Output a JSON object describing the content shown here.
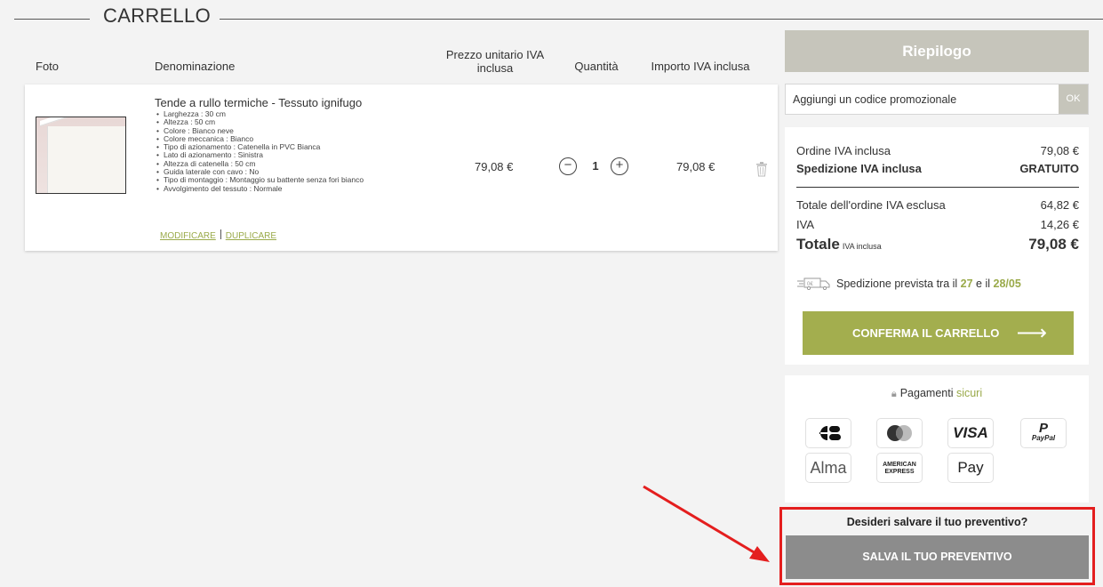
{
  "cart_title": "CARRELLO",
  "table_headers": {
    "photo": "Foto",
    "name": "Denominazione",
    "unit_price": "Prezzo unitario IVA inclusa",
    "quantity": "Quantità",
    "amount": "Importo IVA inclusa"
  },
  "product": {
    "name": "Tende a rullo termiche - Tessuto ignifugo",
    "attributes": [
      "Larghezza : 30 cm",
      "Altezza : 50 cm",
      "Colore : Bianco neve",
      "Colore meccanica : Bianco",
      "Tipo di azionamento : Catenella in PVC Bianca",
      "Lato di azionamento : Sinistra",
      "Altezza di catenella : 50 cm",
      "Guida laterale con cavo : No",
      "Tipo di montaggio : Montaggio su battente senza fori bianco",
      "Avvolgimento del tessuto : Normale"
    ],
    "edit_link": "MODIFICARE",
    "duplicate_link": "DUPLICARE",
    "unit_price": "79,08 €",
    "quantity": "1",
    "amount": "79,08 €"
  },
  "summary": {
    "title": "Riepilogo",
    "promo_placeholder": "Aggiungi un codice promozionale",
    "promo_button": "OK",
    "order_label": "Ordine IVA inclusa",
    "order_value": "79,08 €",
    "shipping_label": "Spedizione IVA inclusa",
    "shipping_value": "GRATUITO",
    "total_excl_label": "Totale dell'ordine IVA esclusa",
    "total_excl_value": "64,82 €",
    "vat_label": "IVA",
    "vat_value": "14,26 €",
    "total_label": "Totale",
    "total_suffix": "IVA inclusa",
    "total_value": "79,08 €",
    "shipping_text_prefix": "Spedizione prevista tra il ",
    "shipping_date_from": "27",
    "shipping_text_mid": " e il ",
    "shipping_date_to": "28/05",
    "truck_label": "0€",
    "confirm_button": "CONFERMA IL CARRELLO"
  },
  "payments": {
    "title_main": "Pagamenti ",
    "title_accent": "sicuri",
    "methods": [
      "CB",
      "Mastercard",
      "VISA",
      "PayPal",
      "Alma",
      "American Express",
      "Apple Pay"
    ],
    "visa_text": "VISA",
    "paypal_text": "PayPal",
    "alma_text": "Alma",
    "amex_line1": "AMERICAN",
    "amex_line2": "EXPRESS",
    "applepay_text": "Pay"
  },
  "save_quote": {
    "question": "Desideri salvare il tuo preventivo?",
    "button": "SALVA IL TUO PREVENTIVO"
  },
  "colors": {
    "accent_green": "#a3ae4e",
    "summary_header": "#c6c5bb",
    "save_button": "#8c8c8c",
    "highlight_red": "#e41e1e"
  }
}
